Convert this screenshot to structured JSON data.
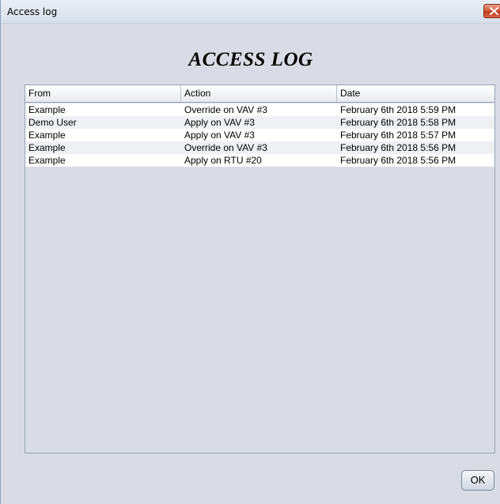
{
  "window": {
    "title": "Access log"
  },
  "heading": "ACCESS LOG",
  "table": {
    "columns": [
      "From",
      "Action",
      "Date"
    ],
    "rows": [
      [
        "Example",
        "Override on VAV #3",
        "February 6th 2018 5:59 PM"
      ],
      [
        "Demo User",
        "Apply on VAV #3",
        "February 6th 2018 5:58 PM"
      ],
      [
        "Example",
        "Apply on VAV #3",
        "February 6th 2018 5:57 PM"
      ],
      [
        "Example",
        "Override on VAV #3",
        "February 6th 2018 5:56 PM"
      ],
      [
        "Example",
        "Apply on RTU #20",
        "February 6th 2018 5:56 PM"
      ]
    ]
  },
  "buttons": {
    "ok_label": "OK"
  },
  "icons": {
    "close": "close-icon"
  },
  "colors": {
    "close_button": "#c23a1c",
    "window_background": "#d9dce4"
  }
}
